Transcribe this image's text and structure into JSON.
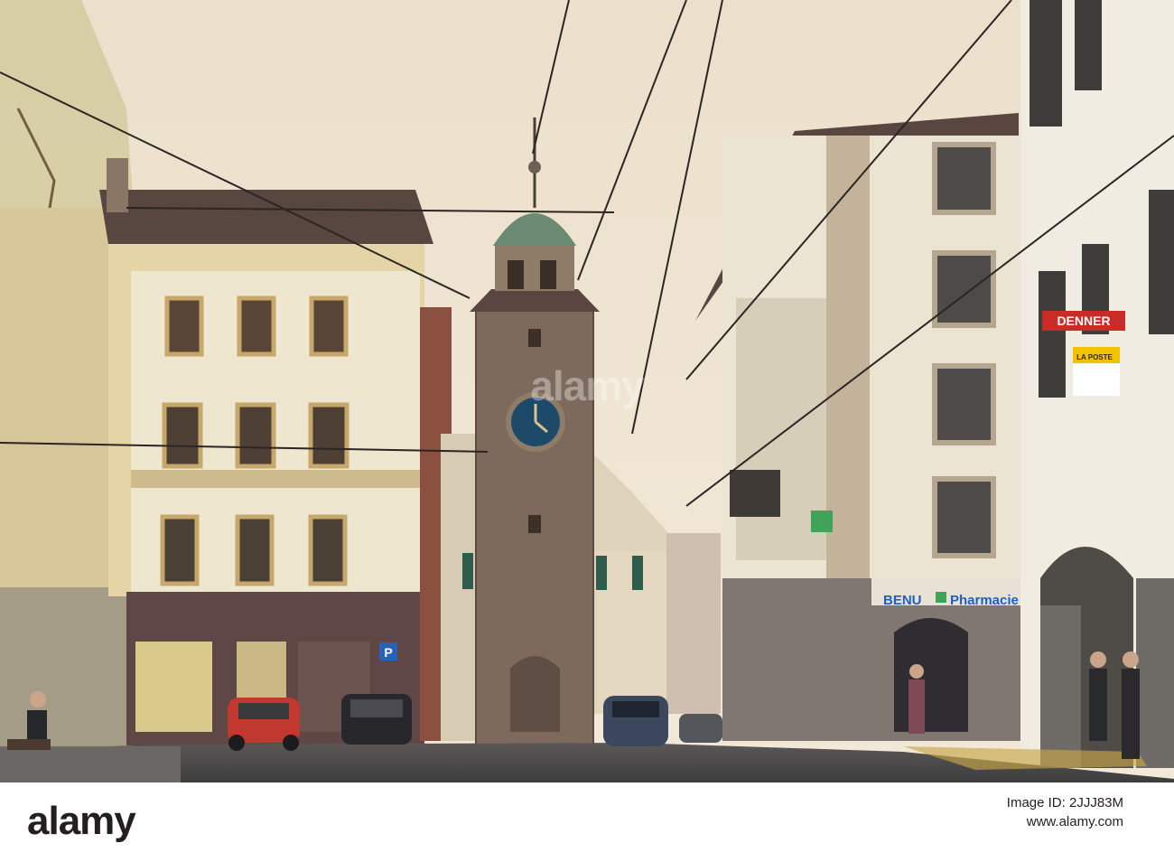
{
  "photo": {
    "scene": "street-with-clock-tower",
    "signs": {
      "denner": "DENNER",
      "la_poste": "LA POSTE",
      "pharmacy": "BENU",
      "pharmacy_word": "Pharmacie",
      "parking": "P"
    },
    "colors": {
      "sky": "#efe3cf",
      "tower_stone": "#7d6a5c",
      "clock_face": "#1e4a6a",
      "roof": "#5a4640",
      "street": "#47474a",
      "pharmacy_blue": "#1f5fc4",
      "denner_red": "#c92b26"
    }
  },
  "stock": {
    "logo": "alamy",
    "watermark": "alamy",
    "image_id": "Image ID: 2JJJ83M",
    "site": "www.alamy.com"
  }
}
